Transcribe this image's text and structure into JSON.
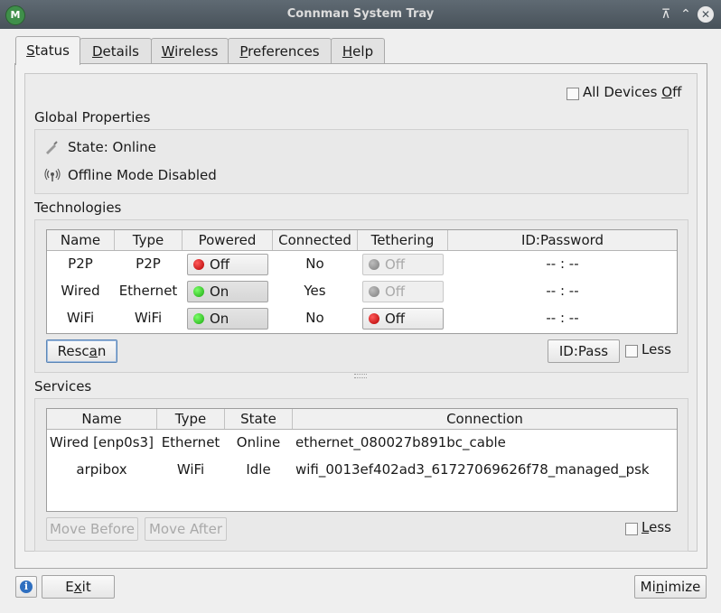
{
  "window": {
    "title": "Connman System Tray",
    "app_icon": "connman-icon"
  },
  "tabs": [
    {
      "label": "Status",
      "key": "S",
      "rest": "tatus",
      "active": true
    },
    {
      "label": "Details",
      "key": "D",
      "rest": "etails"
    },
    {
      "label": "Wireless",
      "key": "W",
      "rest": "ireless"
    },
    {
      "label": "Preferences",
      "key": "P",
      "rest": "references"
    },
    {
      "label": "Help",
      "key": "H",
      "rest": "elp"
    }
  ],
  "status": {
    "all_devices_off": {
      "pre": "All Devices ",
      "key": "O",
      "rest": "ff",
      "checked": false
    },
    "global_properties": {
      "title": "Global Properties",
      "state": "State: Online",
      "offline_mode": "Offline Mode Disabled"
    },
    "technologies": {
      "title": "Technologies",
      "columns": [
        "Name",
        "Type",
        "Powered",
        "Connected",
        "Tethering",
        "ID:Password"
      ],
      "rows": [
        {
          "name": "P2P",
          "type": "P2P",
          "powered": "Off",
          "powered_on": false,
          "connected": "No",
          "tethering": "Off",
          "tethering_state": "disabled",
          "id_password": "-- : --"
        },
        {
          "name": "Wired",
          "type": "Ethernet",
          "powered": "On",
          "powered_on": true,
          "connected": "Yes",
          "tethering": "Off",
          "tethering_state": "disabled",
          "id_password": "-- : --"
        },
        {
          "name": "WiFi",
          "type": "WiFi",
          "powered": "On",
          "powered_on": true,
          "connected": "No",
          "tethering": "Off",
          "tethering_state": "off",
          "id_password": "-- : --"
        }
      ],
      "rescan": {
        "pre": "Resc",
        "key": "a",
        "rest": "n"
      },
      "id_pass_label": "ID:Pass",
      "less_label": "Less"
    },
    "services": {
      "title": "Services",
      "columns": [
        "Name",
        "Type",
        "State",
        "Connection"
      ],
      "rows": [
        {
          "name": "Wired [enp0s3]",
          "type": "Ethernet",
          "state": "Online",
          "connection": "ethernet_080027b891bc_cable"
        },
        {
          "name": "arpibox",
          "type": "WiFi",
          "state": "Idle",
          "connection": "wifi_0013ef402ad3_61727069626f78_managed_psk"
        }
      ],
      "move_before": "Move Before",
      "move_after": "Move After",
      "less": {
        "key": "L",
        "rest": "ess"
      }
    }
  },
  "footer": {
    "exit": {
      "pre": "E",
      "key": "x",
      "rest": "it"
    },
    "minimize": {
      "pre": "Mi",
      "key": "n",
      "rest": "imize"
    }
  },
  "colors": {
    "titlebar": "#48525a",
    "on": "#1aa80e",
    "off": "#b30000",
    "focus": "#5b86b6"
  }
}
